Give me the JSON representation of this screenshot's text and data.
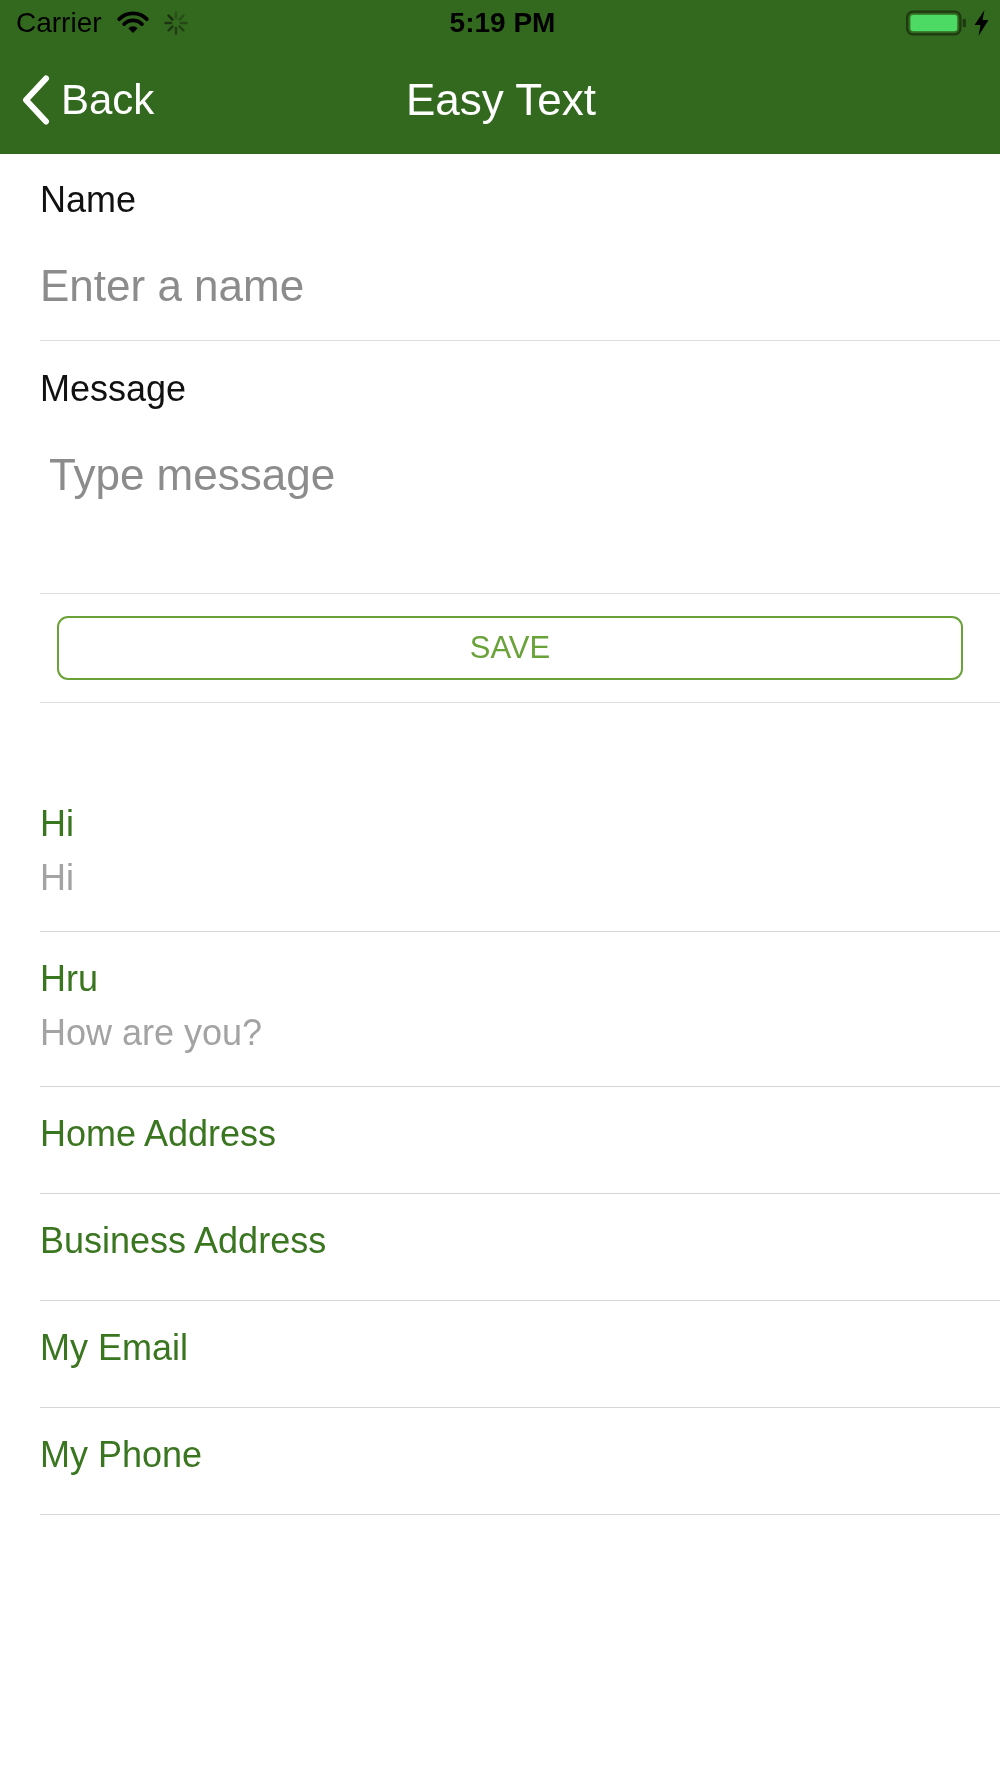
{
  "status_bar": {
    "carrier": "Carrier",
    "time": "5:19 PM"
  },
  "nav_bar": {
    "back_label": "Back",
    "title": "Easy Text"
  },
  "form": {
    "fields": [
      {
        "kind": "text",
        "label": "Name",
        "placeholder": "Enter a name"
      },
      {
        "kind": "multiline",
        "label": "Message",
        "placeholder": "Type message"
      }
    ],
    "save_button": "SAVE"
  },
  "messages": [
    {
      "title": "Hi",
      "text": "Hi"
    },
    {
      "title": "Hru",
      "text": "How are you?"
    },
    {
      "title": "Home Address"
    },
    {
      "title": "Business Address"
    },
    {
      "title": "My Email"
    },
    {
      "title": "My Phone"
    }
  ]
}
